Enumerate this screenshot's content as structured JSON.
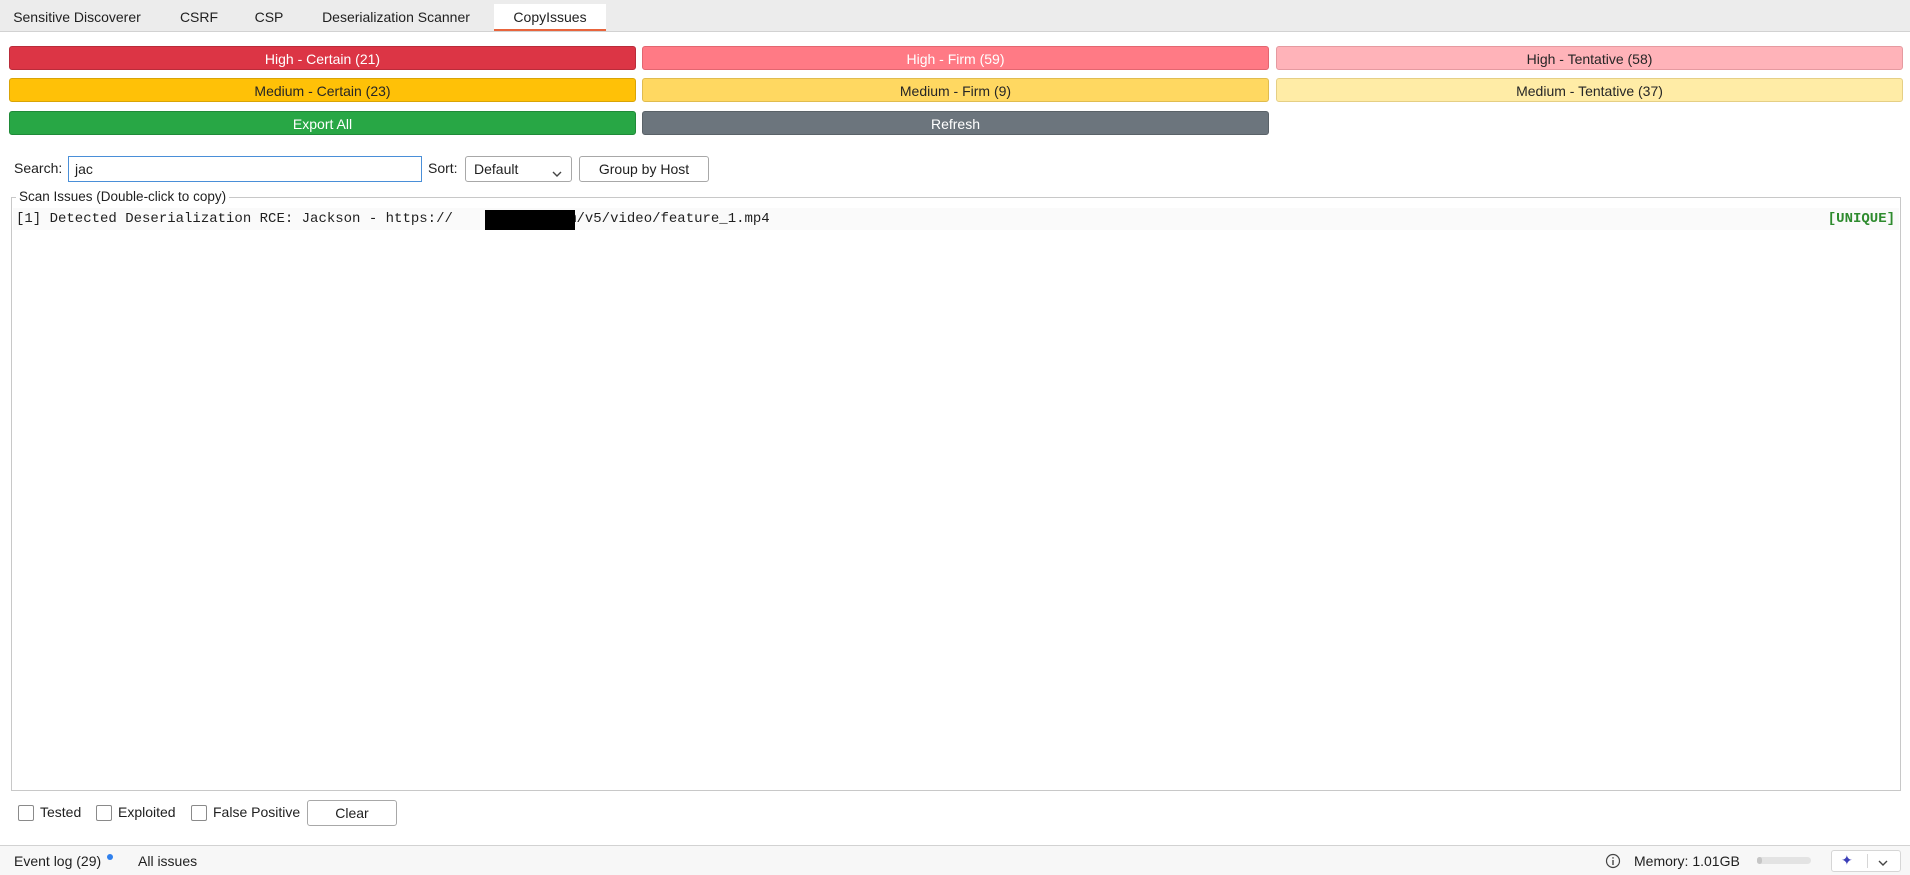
{
  "tabs": [
    {
      "label": "Sensitive Discoverer"
    },
    {
      "label": "CSRF"
    },
    {
      "label": "CSP"
    },
    {
      "label": "Deserialization Scanner"
    },
    {
      "label": "CopyIssues",
      "active": true
    }
  ],
  "severity_buttons": {
    "high_certain": "High - Certain (21)",
    "high_firm": "High - Firm (59)",
    "high_tentative": "High - Tentative (58)",
    "medium_certain": "Medium - Certain (23)",
    "medium_firm": "Medium - Firm (9)",
    "medium_tentative": "Medium - Tentative (37)",
    "export_all": "Export All",
    "refresh": "Refresh"
  },
  "colors": {
    "high_certain": "#dc3545",
    "high_firm": "#ff7a85",
    "high_tentative": "#ffb3b9",
    "medium_certain": "#ffc107",
    "medium_firm": "#ffd861",
    "medium_tentative": "#ffeca6",
    "export_all": "#28a745",
    "refresh": "#6c757d",
    "active_tab_underline": "#e8643c",
    "unique_tag": "#2e8b2e"
  },
  "search": {
    "label": "Search:",
    "value": "jac",
    "sort_label": "Sort:",
    "sort_value": "Default",
    "group_button": "Group by Host"
  },
  "issues": {
    "legend": "Scan Issues (Double-click to copy)",
    "rows": [
      {
        "text_before": "[1] Detected Deserialization RCE: Jackson - https://",
        "text_after": ".com/v5/video/feature_1.mp4",
        "tag": "[UNIQUE]"
      }
    ]
  },
  "filters": {
    "tested": "Tested",
    "exploited": "Exploited",
    "false_positive": "False Positive",
    "clear": "Clear"
  },
  "status_bar": {
    "event_log": "Event log (29)",
    "all_issues": "All issues",
    "memory": "Memory: 1.01GB",
    "memory_usage_fraction": 0.1
  },
  "icons": [
    "info-icon",
    "sparkle-icon",
    "chevron-down-icon"
  ]
}
